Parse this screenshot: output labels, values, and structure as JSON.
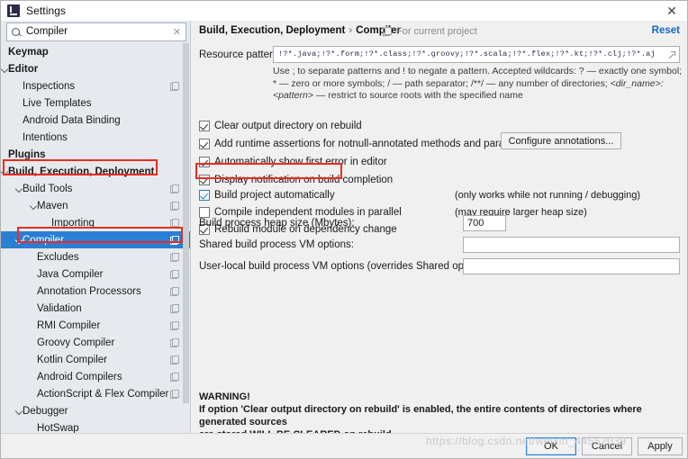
{
  "window": {
    "title": "Settings",
    "app_icon": "intellij-icon",
    "close_label": "✕"
  },
  "sidebar": {
    "search": {
      "value": "Compiler",
      "placeholder": "Search settings",
      "clear_label": "✕"
    },
    "items": [
      {
        "label": "Keymap",
        "indent": 0,
        "bold": true,
        "twisty": false,
        "copy": false,
        "selected": false
      },
      {
        "label": "Editor",
        "indent": 0,
        "bold": true,
        "twisty": true,
        "copy": false,
        "selected": false
      },
      {
        "label": "Inspections",
        "indent": 1,
        "bold": false,
        "twisty": false,
        "copy": true,
        "selected": false
      },
      {
        "label": "Live Templates",
        "indent": 1,
        "bold": false,
        "twisty": false,
        "copy": false,
        "selected": false
      },
      {
        "label": "Android Data Binding",
        "indent": 1,
        "bold": false,
        "twisty": false,
        "copy": false,
        "selected": false
      },
      {
        "label": "Intentions",
        "indent": 1,
        "bold": false,
        "twisty": false,
        "copy": false,
        "selected": false
      },
      {
        "label": "Plugins",
        "indent": 0,
        "bold": true,
        "twisty": false,
        "copy": false,
        "selected": false
      },
      {
        "label": "Build, Execution, Deployment",
        "indent": 0,
        "bold": true,
        "twisty": true,
        "copy": false,
        "selected": false
      },
      {
        "label": "Build Tools",
        "indent": 1,
        "bold": false,
        "twisty": true,
        "copy": true,
        "selected": false
      },
      {
        "label": "Maven",
        "indent": 2,
        "bold": false,
        "twisty": true,
        "copy": true,
        "selected": false
      },
      {
        "label": "Importing",
        "indent": 3,
        "bold": false,
        "twisty": false,
        "copy": true,
        "selected": false
      },
      {
        "label": "Compiler",
        "indent": 1,
        "bold": false,
        "twisty": true,
        "copy": true,
        "selected": true
      },
      {
        "label": "Excludes",
        "indent": 2,
        "bold": false,
        "twisty": false,
        "copy": true,
        "selected": false
      },
      {
        "label": "Java Compiler",
        "indent": 2,
        "bold": false,
        "twisty": false,
        "copy": true,
        "selected": false
      },
      {
        "label": "Annotation Processors",
        "indent": 2,
        "bold": false,
        "twisty": false,
        "copy": true,
        "selected": false
      },
      {
        "label": "Validation",
        "indent": 2,
        "bold": false,
        "twisty": false,
        "copy": true,
        "selected": false
      },
      {
        "label": "RMI Compiler",
        "indent": 2,
        "bold": false,
        "twisty": false,
        "copy": true,
        "selected": false
      },
      {
        "label": "Groovy Compiler",
        "indent": 2,
        "bold": false,
        "twisty": false,
        "copy": true,
        "selected": false
      },
      {
        "label": "Kotlin Compiler",
        "indent": 2,
        "bold": false,
        "twisty": false,
        "copy": true,
        "selected": false
      },
      {
        "label": "Android Compilers",
        "indent": 2,
        "bold": false,
        "twisty": false,
        "copy": true,
        "selected": false
      },
      {
        "label": "ActionScript & Flex Compiler",
        "indent": 2,
        "bold": false,
        "twisty": false,
        "copy": true,
        "selected": false
      },
      {
        "label": "Debugger",
        "indent": 1,
        "bold": false,
        "twisty": true,
        "copy": false,
        "selected": false
      },
      {
        "label": "HotSwap",
        "indent": 2,
        "bold": false,
        "twisty": false,
        "copy": false,
        "selected": false
      }
    ],
    "help_button_label": "?"
  },
  "main": {
    "breadcrumb": {
      "root": "Build, Execution, Deployment",
      "separator": "›",
      "leaf": "Compiler"
    },
    "scope_note": "For current project",
    "reset_label": "Reset",
    "resource_patterns": {
      "label": "Resource patterns:",
      "value": "!?*.java;!?*.form;!?*.class;!?*.groovy;!?*.scala;!?*.flex;!?*.kt;!?*.clj;!?*.aj",
      "help_part1": "Use ; to separate patterns and ! to negate a pattern. Accepted wildcards: ? — exactly one symbol; * — zero or more symbols; / — path separator; /**/ — any number of directories; ",
      "help_italic": "<dir_name>:<pattern>",
      "help_part2": " — restrict to source roots with the specified name"
    },
    "checkboxes": [
      {
        "label": "Clear output directory on rebuild",
        "checked": true,
        "highlight": false,
        "note": ""
      },
      {
        "label": "Add runtime assertions for notnull-annotated methods and parameters",
        "checked": true,
        "highlight": false,
        "note": ""
      },
      {
        "label": "Automatically show first error in editor",
        "checked": true,
        "highlight": false,
        "note": ""
      },
      {
        "label": "Display notification on build completion",
        "checked": true,
        "highlight": false,
        "note": ""
      },
      {
        "label": "Build project automatically",
        "checked": true,
        "highlight": true,
        "note": "(only works while not running / debugging)"
      },
      {
        "label": "Compile independent modules in parallel",
        "checked": false,
        "highlight": false,
        "note": "(may require larger heap size)"
      },
      {
        "label": "Rebuild module on dependency change",
        "checked": true,
        "highlight": false,
        "note": ""
      }
    ],
    "configure_annotations_label": "Configure annotations...",
    "fields": [
      {
        "label": "Build process heap size (Mbytes):",
        "value": "700"
      },
      {
        "label": "Shared build process VM options:",
        "value": ""
      },
      {
        "label": "User-local build process VM options (overrides Shared options):",
        "value": ""
      }
    ],
    "warning": {
      "heading": "WARNING!",
      "line1": "If option 'Clear output directory on rebuild' is enabled, the entire contents of directories where generated sources",
      "line2": "are stored WILL BE CLEARED on rebuild."
    }
  },
  "buttons": {
    "ok": "OK",
    "cancel": "Cancel",
    "apply": "Apply"
  },
  "watermark": "https://blog.csdn.net/weixin_44552039",
  "colors": {
    "selection_blue": "#2a7fd4",
    "link_blue": "#1168c4",
    "annotation_red": "#ee2b20",
    "sidebar_bg": "#e6eaee",
    "panel_bg": "#f0f0f0"
  }
}
